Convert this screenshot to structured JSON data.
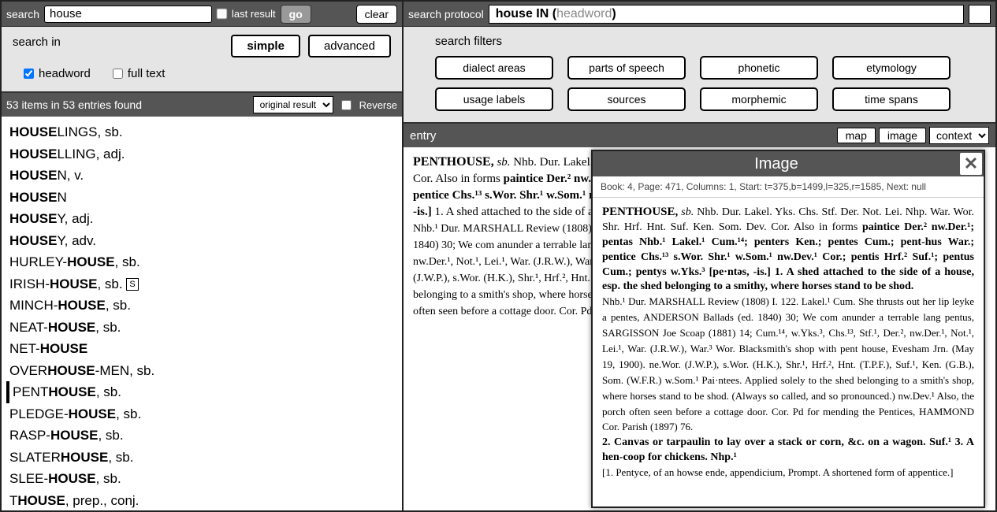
{
  "search": {
    "label": "search",
    "value": "house",
    "last_result_label": "last result",
    "go_label": "go",
    "clear_label": "clear"
  },
  "search_in": {
    "title": "search in",
    "modes": {
      "simple": "simple",
      "advanced": "advanced"
    },
    "options": {
      "headword": "headword",
      "fulltext": "full text"
    },
    "headword_checked": true,
    "fulltext_checked": false
  },
  "results_bar": {
    "count_text": "53 items in 53 entries found",
    "sort_options": [
      "original result"
    ],
    "sort_selected": "original result",
    "reverse_label": "Reverse"
  },
  "results": [
    {
      "pre": "",
      "bold": "HOUSE",
      "post": "LINGS, sb."
    },
    {
      "pre": "",
      "bold": "HOUSE",
      "post": "LLING, adj."
    },
    {
      "pre": "",
      "bold": "HOUSE",
      "post": "N, v."
    },
    {
      "pre": "",
      "bold": "HOUSE",
      "post": "N"
    },
    {
      "pre": "",
      "bold": "HOUSE",
      "post": "Y, adj."
    },
    {
      "pre": "",
      "bold": "HOUSE",
      "post": "Y, adv."
    },
    {
      "pre": "HURLEY-",
      "bold": "HOUSE",
      "post": ", sb."
    },
    {
      "pre": "IRISH-",
      "bold": "HOUSE",
      "post": ", sb.",
      "tag": "S"
    },
    {
      "pre": "MINCH-",
      "bold": "HOUSE",
      "post": ", sb."
    },
    {
      "pre": "NEAT-",
      "bold": "HOUSE",
      "post": ", sb."
    },
    {
      "pre": "NET-",
      "bold": "HOUSE",
      "post": ""
    },
    {
      "pre": "OVER",
      "bold": "HOUSE",
      "post": "-MEN, sb."
    },
    {
      "pre": "PENT",
      "bold": "HOUSE",
      "post": ", sb.",
      "selected": true
    },
    {
      "pre": "PLEDGE-",
      "bold": "HOUSE",
      "post": ", sb."
    },
    {
      "pre": "RASP-",
      "bold": "HOUSE",
      "post": ", sb."
    },
    {
      "pre": "SLATER",
      "bold": "HOUSE",
      "post": ", sb."
    },
    {
      "pre": "SLEE-",
      "bold": "HOUSE",
      "post": ", sb."
    },
    {
      "pre": "T",
      "bold": "HOUSE",
      "post": ", prep., conj."
    }
  ],
  "protocol": {
    "label": "search protocol",
    "prefix": "house IN (",
    "grey": "headword",
    "suffix": ")"
  },
  "filters": {
    "title": "search filters",
    "buttons": [
      "dialect areas",
      "parts of speech",
      "phonetic",
      "etymology",
      "usage labels",
      "sources",
      "morphemic",
      "time spans"
    ]
  },
  "entry_bar": {
    "label": "entry",
    "map": "map",
    "image": "image",
    "context": "context"
  },
  "entry": {
    "headword": "PENTHOUSE,",
    "pos": "sb.",
    "regions": "Nhb. Dur. Lakel. Yks. Chs. Stf. Der. Not. Lei. Nhp. War. Wor. Shr. Hrf. Hnt. Suf. Ken. Som. Dev. Cor.",
    "forms_label": "Also in forms",
    "forms": "paintice Der.² nw.Der.¹; pentas Nhb.¹ Lakel.¹ Cum.¹⁴; penters Ken.; pentes Cum.; pent-hus War.; pentice Chs.¹³ s.Wor. Shr.¹ w.Som.¹ nw.Dev.¹ Cor.; pentis Hrf.² Suf.¹; pentus Cum.; pentys w.Yks.³ [pe·ntəs, pe·ntis, -is.]",
    "sense1": "1. A shed attached to the side of a house, esp. the shed belonging to a smithy, where horses stand to be shod.",
    "cites": "Nhb.¹ Dur. MARSHALL Review (1808) I. 122. Lakel.¹ Cum. She thrusts out her lip leyke a pentes, ANDERSON Ballads (ed. 1840) 30; We com anunder a terrable lang pentus, SARGISSON Joe Scoap (1881) 14; Cum.¹⁴, w.Yks.³, Chs.¹³, Stf.¹, Der.², nw.Der.¹, Not.¹, Lei.¹, War. (J.R.W.), War.³ Wor. Blacksmith's shop with pent house, Evesham Jrn. (May 19, 1900). ne.Wor. (J.W.P.), s.Wor. (H.K.), Shr.¹, Hrf.², Hnt. (T.P.F.), Suf.¹, Ken. (G.B.), Som. (W.F.R.) w.Som.¹ Pai·ntees. Applied solely to the shed belonging to a smith's shop, where horses stand to be shod. (Always so called, and so pronounced.) nw.Dev.¹ Also, the porch often seen before a cottage door. Cor. Pd for mending the Pentices, HAMMOND Cor. Parish (1897) 76."
  },
  "popup": {
    "title": "Image",
    "meta": "Book: 4, Page: 471, Columns: 1, Start: t=375,b=1499,l=325,r=1585, Next: null",
    "headword": "PENTHOUSE,",
    "pos": "sb.",
    "line1": "Nhb. Dur. Lakel. Yks. Chs. Stf. Der. Not. Lei. Nhp. War. Wor. Shr. Hrf. Hnt. Suf. Ken. Som. Dev. Cor.",
    "forms_lbl": "Also in forms",
    "forms": "paintice Der.² nw.Der.¹; pentas Nhb.¹ Lakel.¹ Cum.¹⁴; penters Ken.; pentes Cum.; pent-hus War.; pentice Chs.¹³ s.Wor. Shr.¹ w.Som.¹ nw.Dev.¹ Cor.; pentis Hrf.² Suf.¹; pentus Cum.; pentys w.Yks.³ [pe·ntəs, -is.]",
    "sense1": "1. A shed attached to the side of a house, esp. the shed belonging to a smithy, where horses stand to be shod.",
    "cites1": "Nhb.¹ Dur. MARSHALL Review (1808) I. 122. Lakel.¹ Cum. She thrusts out her lip leyke a pentes, ANDERSON Ballads (ed. 1840) 30; We com anunder a terrable lang pentus, SARGISSON Joe Scoap (1881) 14; Cum.¹⁴, w.Yks.³, Chs.¹³, Stf.¹, Der.², nw.Der.¹, Not.¹, Lei.¹, War. (J.R.W.), War.³ Wor. Blacksmith's shop with pent house, Evesham Jrn. (May 19, 1900). ne.Wor. (J.W.P.), s.Wor. (H.K.), Shr.¹, Hrf.², Hnt. (T.P.F.), Suf.¹, Ken. (G.B.), Som. (W.F.R.) w.Som.¹ Pai·ntees. Applied solely to the shed belonging to a smith's shop, where horses stand to be shod. (Always so called, and so pronounced.) nw.Dev.¹ Also, the porch often seen before a cottage door. Cor. Pd for mending the Pentices, HAMMOND Cor. Parish (1897) 76.",
    "sense2": "2. Canvas or tarpaulin to lay over a stack or corn, &c. on a wagon. Suf.¹",
    "sense3": "3. A hen-coop for chickens. Nhp.¹",
    "etym": "[1. Pentyce, of an howse ende, appendicium, Prompt. A shortened form of appentice.]"
  }
}
